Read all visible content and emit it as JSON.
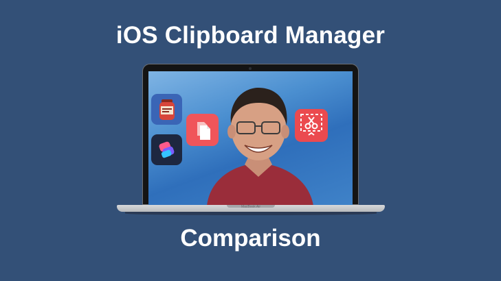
{
  "title": "iOS Clipboard Manager",
  "subtitle": "Comparison",
  "laptop_brand": "MacBook Air",
  "icons": {
    "paste_app": "paste-app-icon",
    "shortcuts_app": "shortcuts-app-icon",
    "copied_app": "copied-app-icon",
    "clip_app": "scissors-clip-app-icon"
  }
}
